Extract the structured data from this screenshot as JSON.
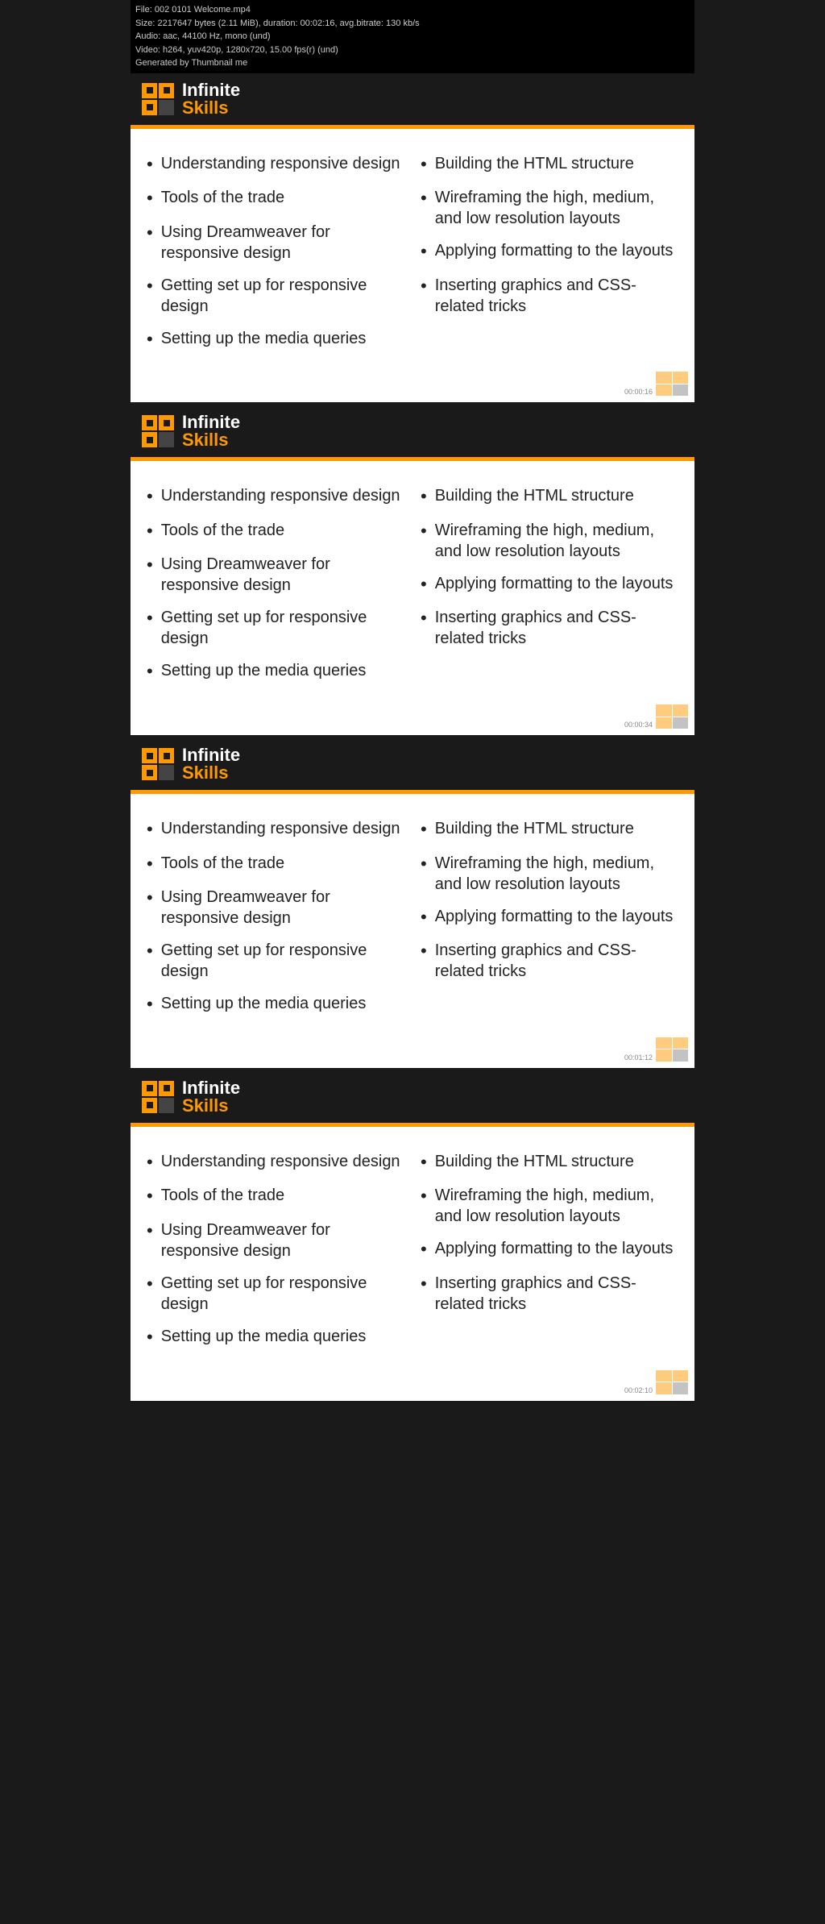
{
  "file_info": {
    "line1": "File: 002 0101 Welcome.mp4",
    "line2": "Size: 2217647 bytes (2.11 MiB), duration: 00:02:16, avg.bitrate: 130 kb/s",
    "line3": "Audio: aac, 44100 Hz, mono (und)",
    "line4": "Video: h264, yuv420p, 1280x720, 15.00 fps(r) (und)",
    "line5": "Generated by Thumbnail me"
  },
  "brand": {
    "name": "Infinite",
    "sub": "Skills"
  },
  "slides": [
    {
      "id": "slide1",
      "timestamp": "00:00:16",
      "left_items": [
        "Understanding responsive design",
        "Tools of the trade",
        "Using Dreamweaver for responsive design",
        "Getting set up for responsive design",
        "Setting up the media queries"
      ],
      "right_items": [
        "Building the HTML structure",
        "Wireframing the high, medium, and low resolution layouts",
        "Applying formatting to the layouts",
        "Inserting graphics and CSS-related tricks"
      ]
    },
    {
      "id": "slide2",
      "timestamp": "00:00:34",
      "left_items": [
        "Understanding responsive design",
        "Tools of the trade",
        "Using Dreamweaver for responsive design",
        "Getting set up for responsive design",
        "Setting up the media queries"
      ],
      "right_items": [
        "Building the HTML structure",
        "Wireframing the high, medium, and low resolution layouts",
        "Applying formatting to the layouts",
        "Inserting graphics and CSS-related tricks"
      ]
    },
    {
      "id": "slide3",
      "timestamp": "00:01:12",
      "left_items": [
        "Understanding responsive design",
        "Tools of the trade",
        "Using Dreamweaver for responsive design",
        "Getting set up for responsive design",
        "Setting up the media queries"
      ],
      "right_items": [
        "Building the HTML structure",
        "Wireframing the high, medium, and low resolution layouts",
        "Applying formatting to the layouts",
        "Inserting graphics and CSS-related tricks"
      ]
    },
    {
      "id": "slide4",
      "timestamp": "00:02:10",
      "left_items": [
        "Understanding responsive design",
        "Tools of the trade",
        "Using Dreamweaver for responsive design",
        "Getting set up for responsive design",
        "Setting up the media queries"
      ],
      "right_items": [
        "Building the HTML structure",
        "Wireframing the high, medium, and low resolution layouts",
        "Applying formatting to the layouts",
        "Inserting graphics and CSS-related tricks"
      ]
    }
  ]
}
